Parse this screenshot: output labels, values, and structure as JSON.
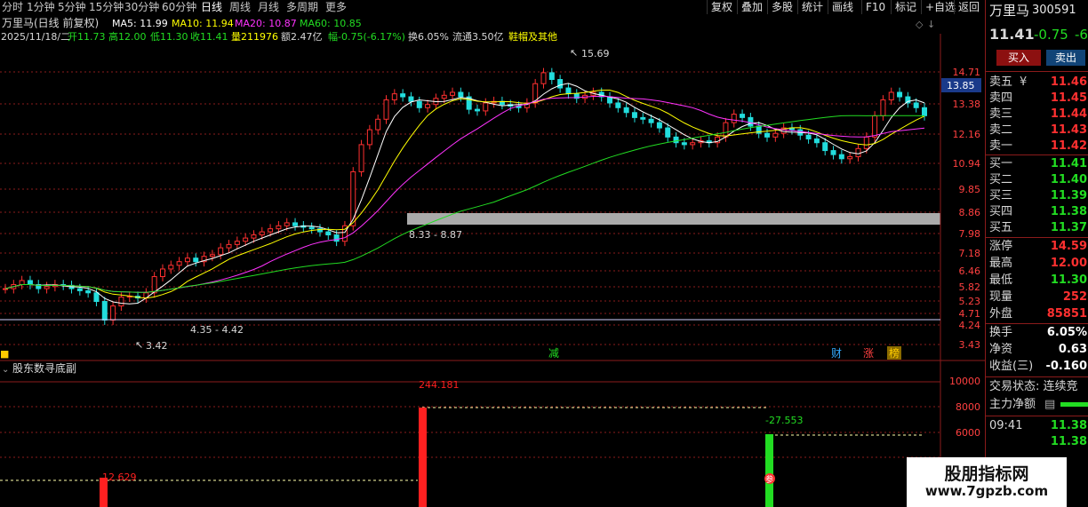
{
  "toolbar": {
    "stock_tab": "万里马",
    "periods": [
      "分时",
      "1分钟",
      "5分钟",
      "15分钟",
      "30分钟",
      "60分钟",
      "日线",
      "周线",
      "月线",
      "多周期",
      "更多"
    ],
    "active_period": "日线",
    "tools": [
      "复权",
      "叠加",
      "多股",
      "统计",
      "画线",
      "F10",
      "标记",
      "+自选",
      "返回"
    ]
  },
  "info": {
    "title": "万里马(日线 前复权)",
    "ma5": "MA5: 11.99",
    "ma10": "MA10: 11.94",
    "ma20": "MA20: 10.87",
    "ma60": "MA60: 10.85",
    "date": "2025/11/18/二",
    "open": "开11.73",
    "high": "高12.00",
    "low": "低11.30",
    "close": "收11.41",
    "volume": "量211976",
    "amount": "额2.47亿",
    "change": "幅-0.75(-6.17%)",
    "turnover": "换6.05%",
    "float_cap": "流通3.50亿",
    "concepts": "鞋帽及其他"
  },
  "price_axis": [
    "14.71",
    "13.38",
    "12.16",
    "10.94",
    "9.85",
    "8.86",
    "7.98",
    "7.18",
    "6.46",
    "5.82",
    "5.23",
    "4.71",
    "4.24",
    "3.43"
  ],
  "crosshair_price": "13.85",
  "annotations": {
    "high": "15.69",
    "low": "3.42",
    "range1": "4.35 - 4.42",
    "range2": "8.33 - 8.87",
    "event_jian": "减",
    "event_cai": "财",
    "event_zhang": "涨",
    "event_bang": "榜",
    "event_can": "参"
  },
  "sub_chart": {
    "title": "股东数寻底副",
    "axis": [
      "10000",
      "8000",
      "6000"
    ],
    "labels": [
      "244.181",
      "-27.553",
      "12.629"
    ]
  },
  "chart_data": {
    "type": "candlestick",
    "ylim": [
      3.43,
      15.69
    ],
    "highest": 15.69,
    "lowest": 3.42,
    "highlight_band": [
      8.33,
      8.87
    ],
    "series": [
      {
        "name": "MA5",
        "value": 11.99,
        "color": "#ffffff"
      },
      {
        "name": "MA10",
        "value": 11.94,
        "color": "#ffff00"
      },
      {
        "name": "MA20",
        "value": 10.87,
        "color": "#ff33ff"
      },
      {
        "name": "MA60",
        "value": 10.85,
        "color": "#22dd22"
      }
    ],
    "close_series": [
      4.6,
      4.7,
      4.8,
      4.7,
      4.6,
      4.65,
      4.7,
      4.68,
      4.6,
      4.55,
      4.5,
      4.3,
      3.9,
      4.2,
      4.4,
      4.42,
      4.38,
      4.5,
      4.9,
      5.1,
      5.2,
      5.3,
      5.4,
      5.3,
      5.45,
      5.5,
      5.7,
      5.8,
      5.9,
      6.0,
      6.1,
      6.2,
      6.3,
      6.4,
      6.5,
      6.4,
      6.35,
      6.3,
      6.2,
      6.1,
      5.9,
      6.4,
      8.5,
      9.8,
      10.6,
      11.2,
      12.4,
      12.8,
      12.6,
      12.3,
      11.9,
      12.1,
      12.5,
      12.7,
      12.9,
      12.6,
      11.8,
      11.7,
      12.2,
      12.3,
      12.1,
      12.0,
      11.9,
      12.2,
      13.5,
      14.3,
      13.8,
      13.2,
      12.8,
      12.5,
      12.7,
      12.9,
      12.6,
      12.2,
      11.9,
      11.6,
      11.3,
      11.2,
      11.0,
      10.7,
      10.2,
      9.9,
      9.8,
      9.9,
      10.0,
      9.9,
      10.2,
      11.0,
      11.5,
      11.3,
      10.8,
      10.4,
      10.2,
      10.4,
      10.7,
      10.6,
      10.3,
      10.1,
      9.9,
      9.5,
      9.3,
      9.1,
      9.2,
      9.6,
      10.2,
      11.4,
      12.4,
      12.9,
      12.6,
      12.2,
      11.9,
      11.41
    ],
    "sub_bars": [
      {
        "label": "12.629",
        "value": 12.629,
        "color": "#ff2020"
      },
      {
        "label": "244.181",
        "value": 244.181,
        "color": "#ff2020"
      },
      {
        "label": "-27.553",
        "value": -27.553,
        "color": "#22dd22"
      }
    ]
  },
  "panel": {
    "name": "万里马",
    "code": "300591",
    "price": "11.41",
    "change": "-0.75",
    "pct": "-6",
    "buy_btn": "买入",
    "sell_btn": "卖出",
    "asks": [
      {
        "label": "卖五",
        "price": "11.46"
      },
      {
        "label": "卖四",
        "price": "11.45"
      },
      {
        "label": "卖三",
        "price": "11.44"
      },
      {
        "label": "卖二",
        "price": "11.43"
      },
      {
        "label": "卖一",
        "price": "11.42"
      }
    ],
    "bids": [
      {
        "label": "买一",
        "price": "11.41"
      },
      {
        "label": "买二",
        "price": "11.40"
      },
      {
        "label": "买三",
        "price": "11.39"
      },
      {
        "label": "买四",
        "price": "11.38"
      },
      {
        "label": "买五",
        "price": "11.37"
      }
    ],
    "stats": [
      {
        "label": "涨停",
        "value": "14.59",
        "cls": "red"
      },
      {
        "label": "最高",
        "value": "12.00",
        "cls": "red"
      },
      {
        "label": "最低",
        "value": "11.30",
        "cls": "green"
      },
      {
        "label": "现量",
        "value": "252",
        "cls": "red"
      },
      {
        "label": "外盘",
        "value": "85851",
        "cls": "red"
      }
    ],
    "stats2": [
      {
        "label": "换手",
        "value": "6.05%",
        "cls": "white"
      },
      {
        "label": "净资",
        "value": "0.63",
        "cls": "white"
      },
      {
        "label": "收益(三)",
        "value": "-0.160",
        "cls": "white"
      }
    ],
    "trade_status": "交易状态: 连续竞",
    "main_flow": "主力净额",
    "time": "09:41",
    "tick1": "11.38",
    "tick2": "11.38"
  },
  "watermark": {
    "title": "股朋指标网",
    "url": "www.7gpzb.com"
  }
}
